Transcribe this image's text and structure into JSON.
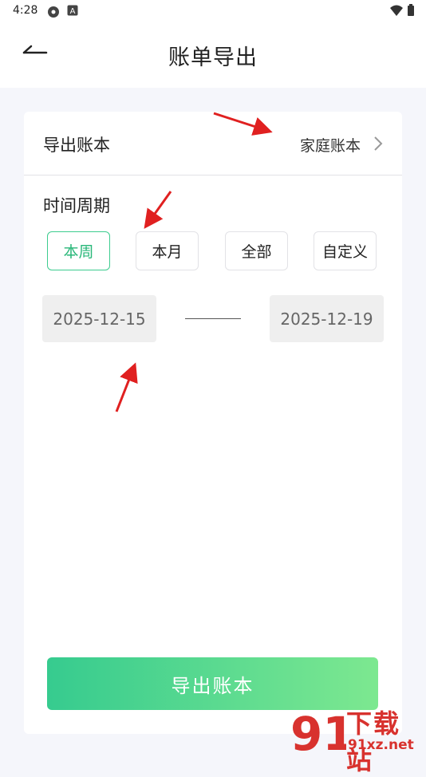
{
  "status_bar": {
    "time": "4:28",
    "icons_left": [
      "settings-gear-icon",
      "a-letter-icon"
    ],
    "icons_right": [
      "wifi-icon",
      "battery-icon"
    ]
  },
  "header": {
    "title": "账单导出",
    "back_icon": "back-arrow-icon"
  },
  "ledger": {
    "label": "导出账本",
    "value": "家庭账本",
    "chevron_icon": "chevron-right-icon"
  },
  "period": {
    "label": "时间周期",
    "options": [
      "本周",
      "本月",
      "全部",
      "自定义"
    ],
    "selected": "本周",
    "start_date": "2025-12-15",
    "end_date": "2025-12-19"
  },
  "export_button": {
    "label": "导出账本"
  },
  "watermark": {
    "logo_text": "91",
    "title": "下载站",
    "site": "91xz.net"
  },
  "colors": {
    "accent_green": "#29b779",
    "button_gradient_start": "#36cb8f",
    "button_gradient_end": "#7de890",
    "annotation_red": "#e02020",
    "watermark_red": "#d8322e"
  }
}
